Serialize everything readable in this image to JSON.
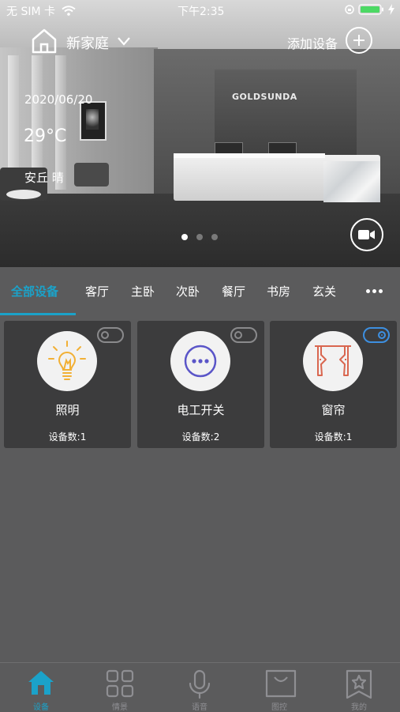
{
  "status_bar": {
    "carrier": "无 SIM 卡",
    "time": "下午2:35"
  },
  "header": {
    "home_name": "新家庭",
    "add_label": "添加设备"
  },
  "banner": {
    "date": "2020/06/20",
    "temperature": "29°C",
    "location_weather": "安丘 晴",
    "brand_sign": "GOLDSUNDA"
  },
  "room_tabs": [
    "全部设备",
    "客厅",
    "主卧",
    "次卧",
    "餐厅",
    "书房",
    "玄关"
  ],
  "devices": [
    {
      "name": "照明",
      "count": "设备数:1",
      "toggle_on": false,
      "icon": "lightbulb-icon"
    },
    {
      "name": "电工开关",
      "count": "设备数:2",
      "toggle_on": false,
      "icon": "more-dots-icon"
    },
    {
      "name": "窗帘",
      "count": "设备数:1",
      "toggle_on": true,
      "icon": "curtain-icon"
    }
  ],
  "bottom_nav": [
    "设备",
    "情景",
    "语音",
    "图控",
    "我的"
  ],
  "colors": {
    "accent": "#1ba2c9",
    "toggle_on": "#3d8fe0",
    "bulb": "#f2b035",
    "switch": "#5a55c8",
    "curtain": "#d9664f"
  }
}
